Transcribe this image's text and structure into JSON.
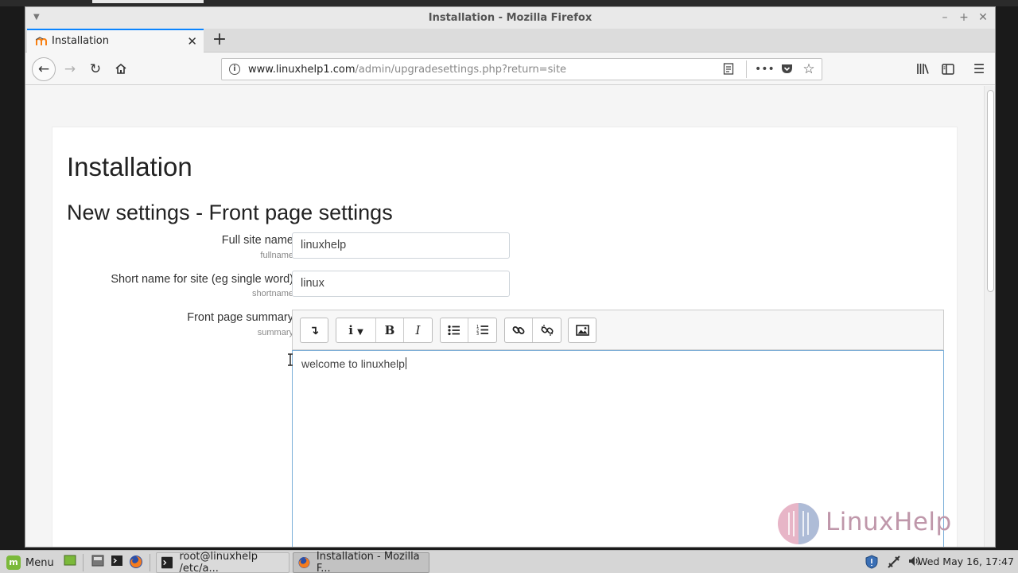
{
  "window": {
    "title": "Installation - Mozilla Firefox"
  },
  "tab": {
    "label": "Installation"
  },
  "urlbar": {
    "host": "www.linuxhelp1.com",
    "path": "/admin/upgradesettings.php?return=site"
  },
  "page": {
    "heading": "Installation",
    "subheading": "New settings - Front page settings",
    "fields": [
      {
        "label": "Full site name",
        "sub": "fullname",
        "value": "linuxhelp"
      },
      {
        "label": "Short name for site (eg single word)",
        "sub": "shortname",
        "value": "linux"
      },
      {
        "label": "Front page summary",
        "sub": "summary",
        "value": "welcome to linuxhelp"
      }
    ]
  },
  "editor_toolbar": {
    "buttons": [
      "expand-icon",
      "info-icon",
      "bold-icon",
      "italic-icon",
      "bullet-list-icon",
      "numbered-list-icon",
      "link-icon",
      "unlink-icon",
      "image-icon"
    ]
  },
  "watermark": {
    "text": "LinuxHelp"
  },
  "taskbar": {
    "menu_label": "Menu",
    "tasks": [
      {
        "label": "root@linuxhelp /etc/a..."
      },
      {
        "label": "Installation - Mozilla F..."
      }
    ],
    "clock": "Wed May 16, 17:47"
  },
  "colors": {
    "tab_accent": "#0a84ff",
    "editor_focus": "#7aaed8",
    "watermark": "#bf97aa"
  }
}
